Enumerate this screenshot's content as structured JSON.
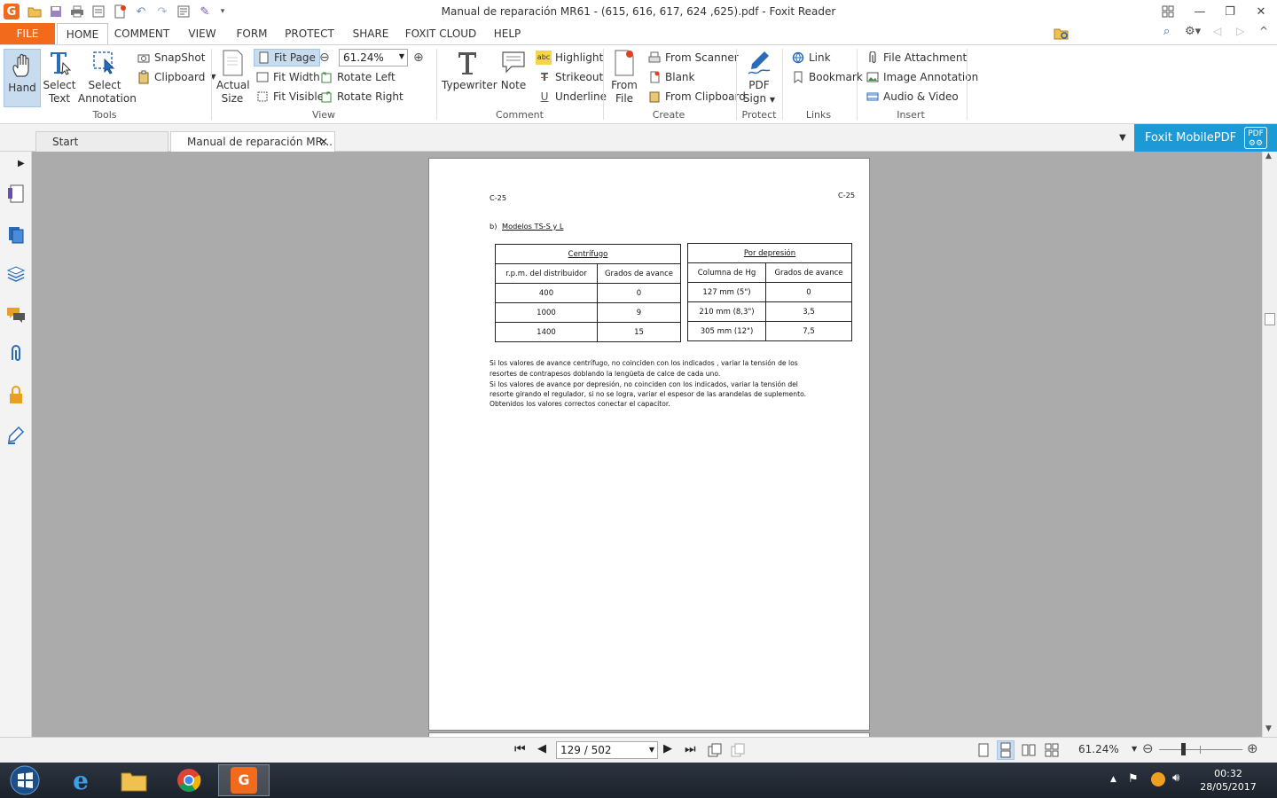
{
  "window": {
    "title": "Manual de reparación MR61 - (615, 616, 617, 624 ,625).pdf - Foxit Reader"
  },
  "menu": {
    "file": "FILE",
    "tabs": [
      "HOME",
      "COMMENT",
      "VIEW",
      "FORM",
      "PROTECT",
      "SHARE",
      "FOXIT CLOUD",
      "HELP"
    ]
  },
  "search": {
    "placeholder": "Find"
  },
  "ribbon": {
    "hand": "Hand",
    "select_text_1": "Select",
    "select_text_2": "Text",
    "select_annot_1": "Select",
    "select_annot_2": "Annotation",
    "snapshot": "SnapShot",
    "clipboard": "Clipboard",
    "tools_group": "Tools",
    "actual_size_1": "Actual",
    "actual_size_2": "Size",
    "fit_page": "Fit Page",
    "fit_width": "Fit Width",
    "fit_visible": "Fit Visible",
    "zoom_value": "61.24%",
    "rotate_left": "Rotate Left",
    "rotate_right": "Rotate Right",
    "view_group": "View",
    "typewriter": "Typewriter",
    "note": "Note",
    "highlight": "Highlight",
    "strikeout": "Strikeout",
    "underline": "Underline",
    "comment_group": "Comment",
    "from_file_1": "From",
    "from_file_2": "File",
    "from_scanner": "From Scanner",
    "blank": "Blank",
    "from_clipboard": "From Clipboard",
    "create_group": "Create",
    "pdf_sign_1": "PDF",
    "pdf_sign_2": "Sign",
    "protect_group": "Protect",
    "link": "Link",
    "bookmark": "Bookmark",
    "links_group": "Links",
    "file_attachment": "File Attachment",
    "image_annotation": "Image Annotation",
    "audio_video": "Audio & Video",
    "insert_group": "Insert"
  },
  "tabs": {
    "start": "Start",
    "doc": "Manual de reparación MR..."
  },
  "mobile": "Foxit MobilePDF",
  "document": {
    "header_left": "C-25",
    "header_right": "C-25",
    "section": "b)",
    "section_title": "Modelos  TS-S  y  L",
    "table1": {
      "title": "Centrífugo",
      "col1": "r.p.m.  del  distribuidor",
      "col2": "Grados  de  avance",
      "rows": [
        [
          "400",
          "0"
        ],
        [
          "1000",
          "9"
        ],
        [
          "1400",
          "15"
        ]
      ]
    },
    "table2": {
      "title": "Por  depresión",
      "col1": "Columna  de  Hg",
      "col2": "Grados  de  avance",
      "rows": [
        [
          "127  mm  (5\")",
          "0"
        ],
        [
          "210  mm  (8,3\")",
          "3,5"
        ],
        [
          "305  mm  (12\")",
          "7,5"
        ]
      ]
    },
    "para": [
      "Si  los  valores  de  avance  centrífugo,  no  coinciden  con  los  indicados ,  variar  la  tensión  de  los",
      "resortes  de  contrapesos  doblando  la  lengüeta  de  calce  de  cada  uno.",
      "Si  los  valores  de  avance  por  depresión,  no  coinciden  con  los  indicados,  variar  la  tensión  del",
      "resorte  girando  el  regulador,  si  no  se  logra,  variar  el  espesor  de  las  arandelas  de  suplemento.",
      "Obtenidos  los  valores  correctos  conectar  el  capacitor."
    ]
  },
  "status": {
    "page": "129 / 502",
    "zoom": "61.24%"
  },
  "taskbar": {
    "time": "00:32",
    "date": "28/05/2017"
  }
}
